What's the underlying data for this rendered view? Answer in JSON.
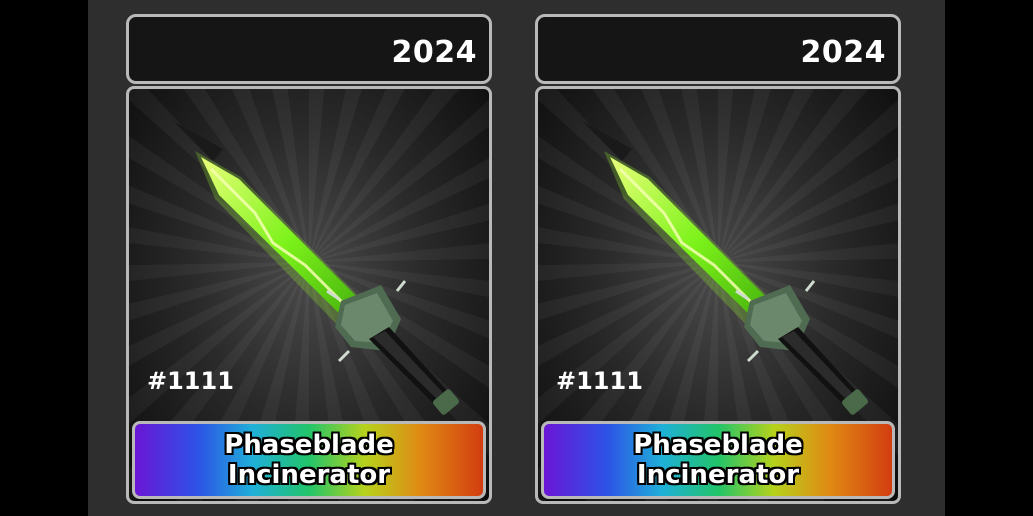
{
  "cards": [
    {
      "year": "2024",
      "serial": "#1111",
      "name_line1": "Phaseblade",
      "name_line2": "Incinerator",
      "weapon_icon": "green-energy-dagger-icon",
      "rarity_colors": [
        "#6a16d6",
        "#2d52e6",
        "#1fb0d8",
        "#22c46a",
        "#b6d21c",
        "#e08a14",
        "#d23d10"
      ]
    },
    {
      "year": "2024",
      "serial": "#1111",
      "name_line1": "Phaseblade",
      "name_line2": "Incinerator",
      "weapon_icon": "green-energy-dagger-icon",
      "rarity_colors": [
        "#6a16d6",
        "#2d52e6",
        "#1fb0d8",
        "#22c46a",
        "#b6d21c",
        "#e08a14",
        "#d23d10"
      ]
    }
  ],
  "colors": {
    "frame": "#b9b9b9",
    "blade_glow": "#8fff1a",
    "background": "#2e2e2e"
  }
}
